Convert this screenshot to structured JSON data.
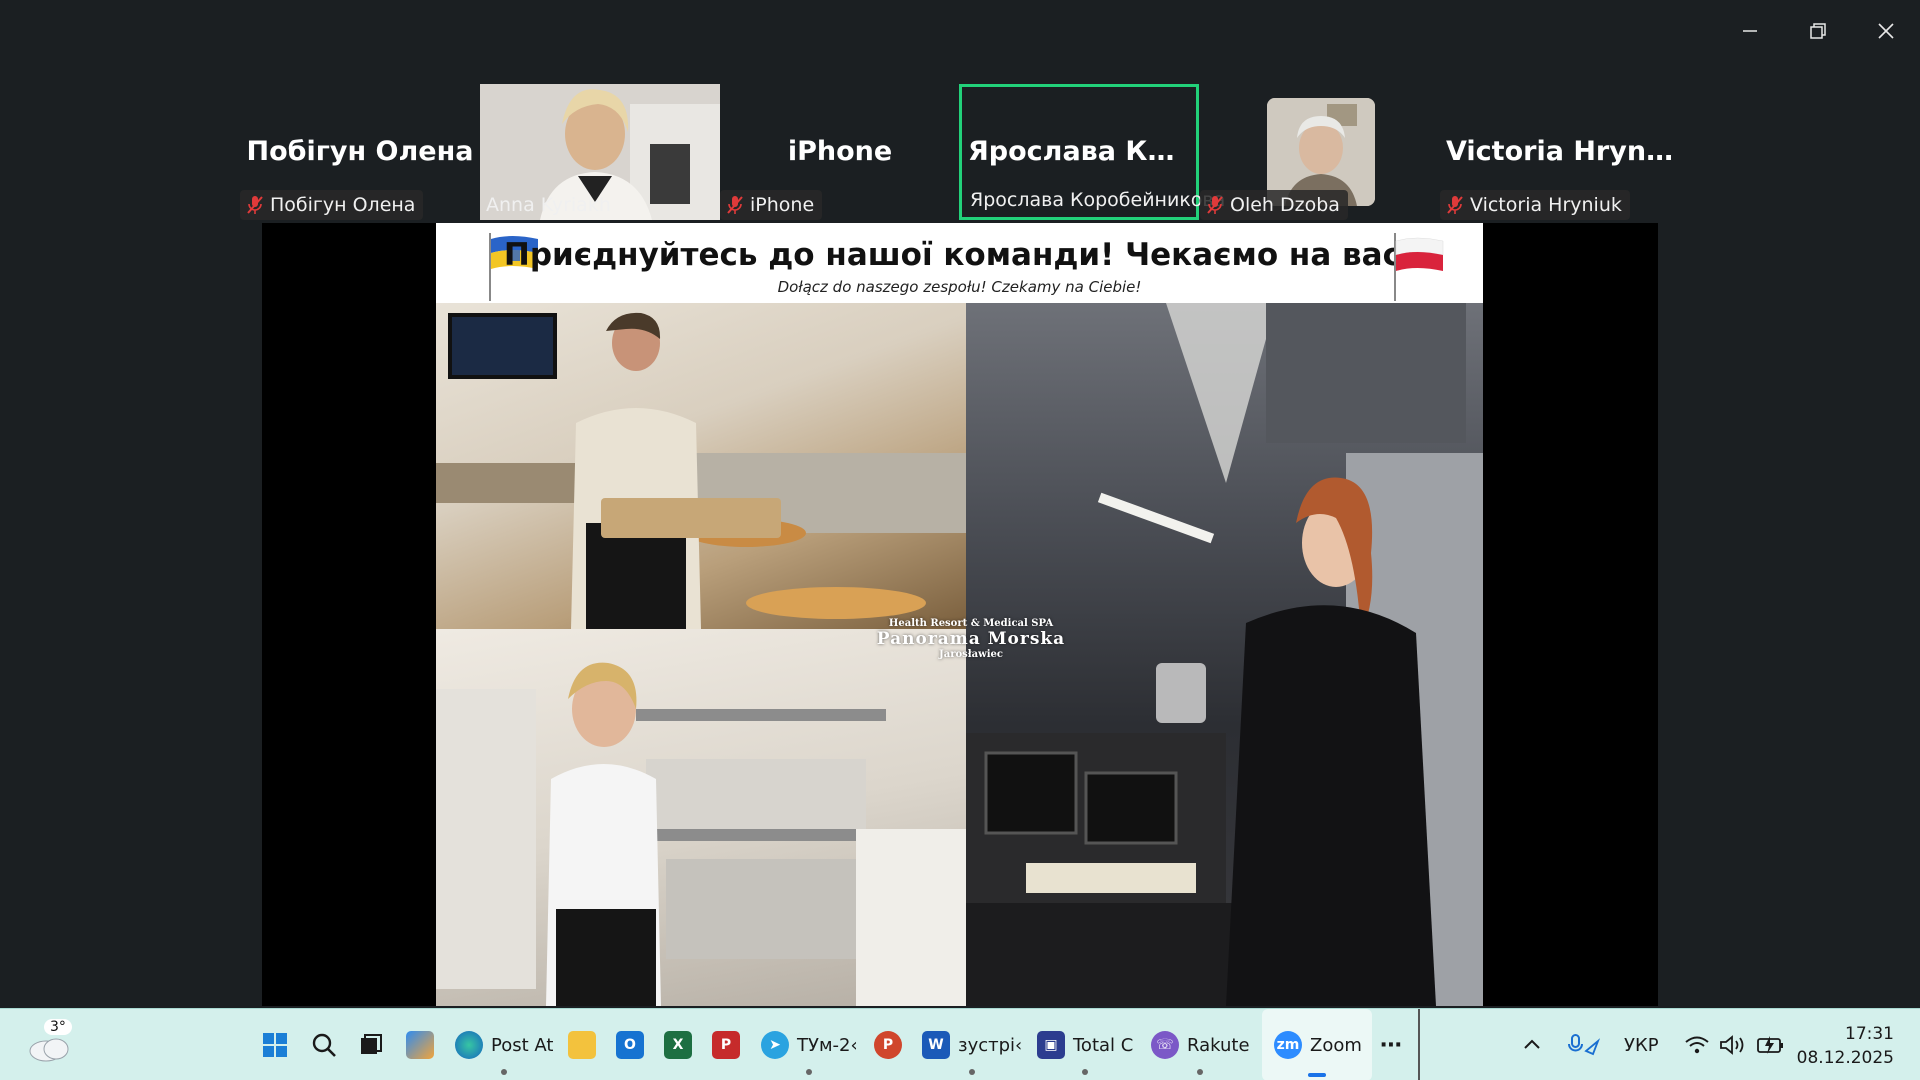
{
  "window": {
    "minimize_icon": "minimize-icon",
    "restore_icon": "restore-icon",
    "close_icon": "close-icon"
  },
  "participants": [
    {
      "display_name": "Побігун Олена",
      "label": "Побігун Олена",
      "muted": true,
      "video": false
    },
    {
      "display_name": "",
      "label": "Anna Kyriakh",
      "muted": false,
      "video": true
    },
    {
      "display_name": "iPhone",
      "label": "iPhone",
      "muted": true,
      "video": false
    },
    {
      "display_name": "Ярослава  Коро...",
      "label": "Ярослава Коробейникова",
      "muted": false,
      "video": false,
      "active": true
    },
    {
      "display_name": "",
      "label": "Oleh Dzoba",
      "muted": true,
      "video": false,
      "avatar": true
    },
    {
      "display_name": "Victoria Hryniuk",
      "label": "Victoria Hryniuk",
      "muted": true,
      "video": false
    }
  ],
  "slide": {
    "title": "Приєднуйтесь до нашої команди! Чекаємо на вас!",
    "subtitle": "Dołącz do naszego zespołu! Czekamy na Ciebie!",
    "logo_line1": "Health Resort & Medical SPA",
    "logo_line2": "Panorama Morska",
    "logo_line3": "Jarosławiec",
    "flag_left": "ukraine-flag",
    "flag_right": "poland-flag"
  },
  "taskbar": {
    "weather_temp": "3°",
    "items": [
      {
        "name": "windows-start",
        "label": ""
      },
      {
        "name": "search",
        "label": ""
      },
      {
        "name": "task-view",
        "label": ""
      },
      {
        "name": "copilot",
        "label": ""
      },
      {
        "name": "edge",
        "label": "Post At"
      },
      {
        "name": "file-explorer",
        "label": ""
      },
      {
        "name": "outlook",
        "label": ""
      },
      {
        "name": "excel",
        "label": ""
      },
      {
        "name": "pdf",
        "label": ""
      },
      {
        "name": "telegram",
        "label": "ТУм-2‹"
      },
      {
        "name": "powerpoint",
        "label": ""
      },
      {
        "name": "word",
        "label": "зустрі‹"
      },
      {
        "name": "total-commander",
        "label": "Total C"
      },
      {
        "name": "rakuten-viber",
        "label": "Rakute"
      },
      {
        "name": "zoom",
        "label": "Zoom"
      }
    ],
    "language": "УКР",
    "time": "17:31",
    "date": "08.12.2025"
  },
  "colors": {
    "active_speaker": "#22d17a",
    "taskbar_bg": "#d4f0ec",
    "background": "#1b1f22"
  }
}
